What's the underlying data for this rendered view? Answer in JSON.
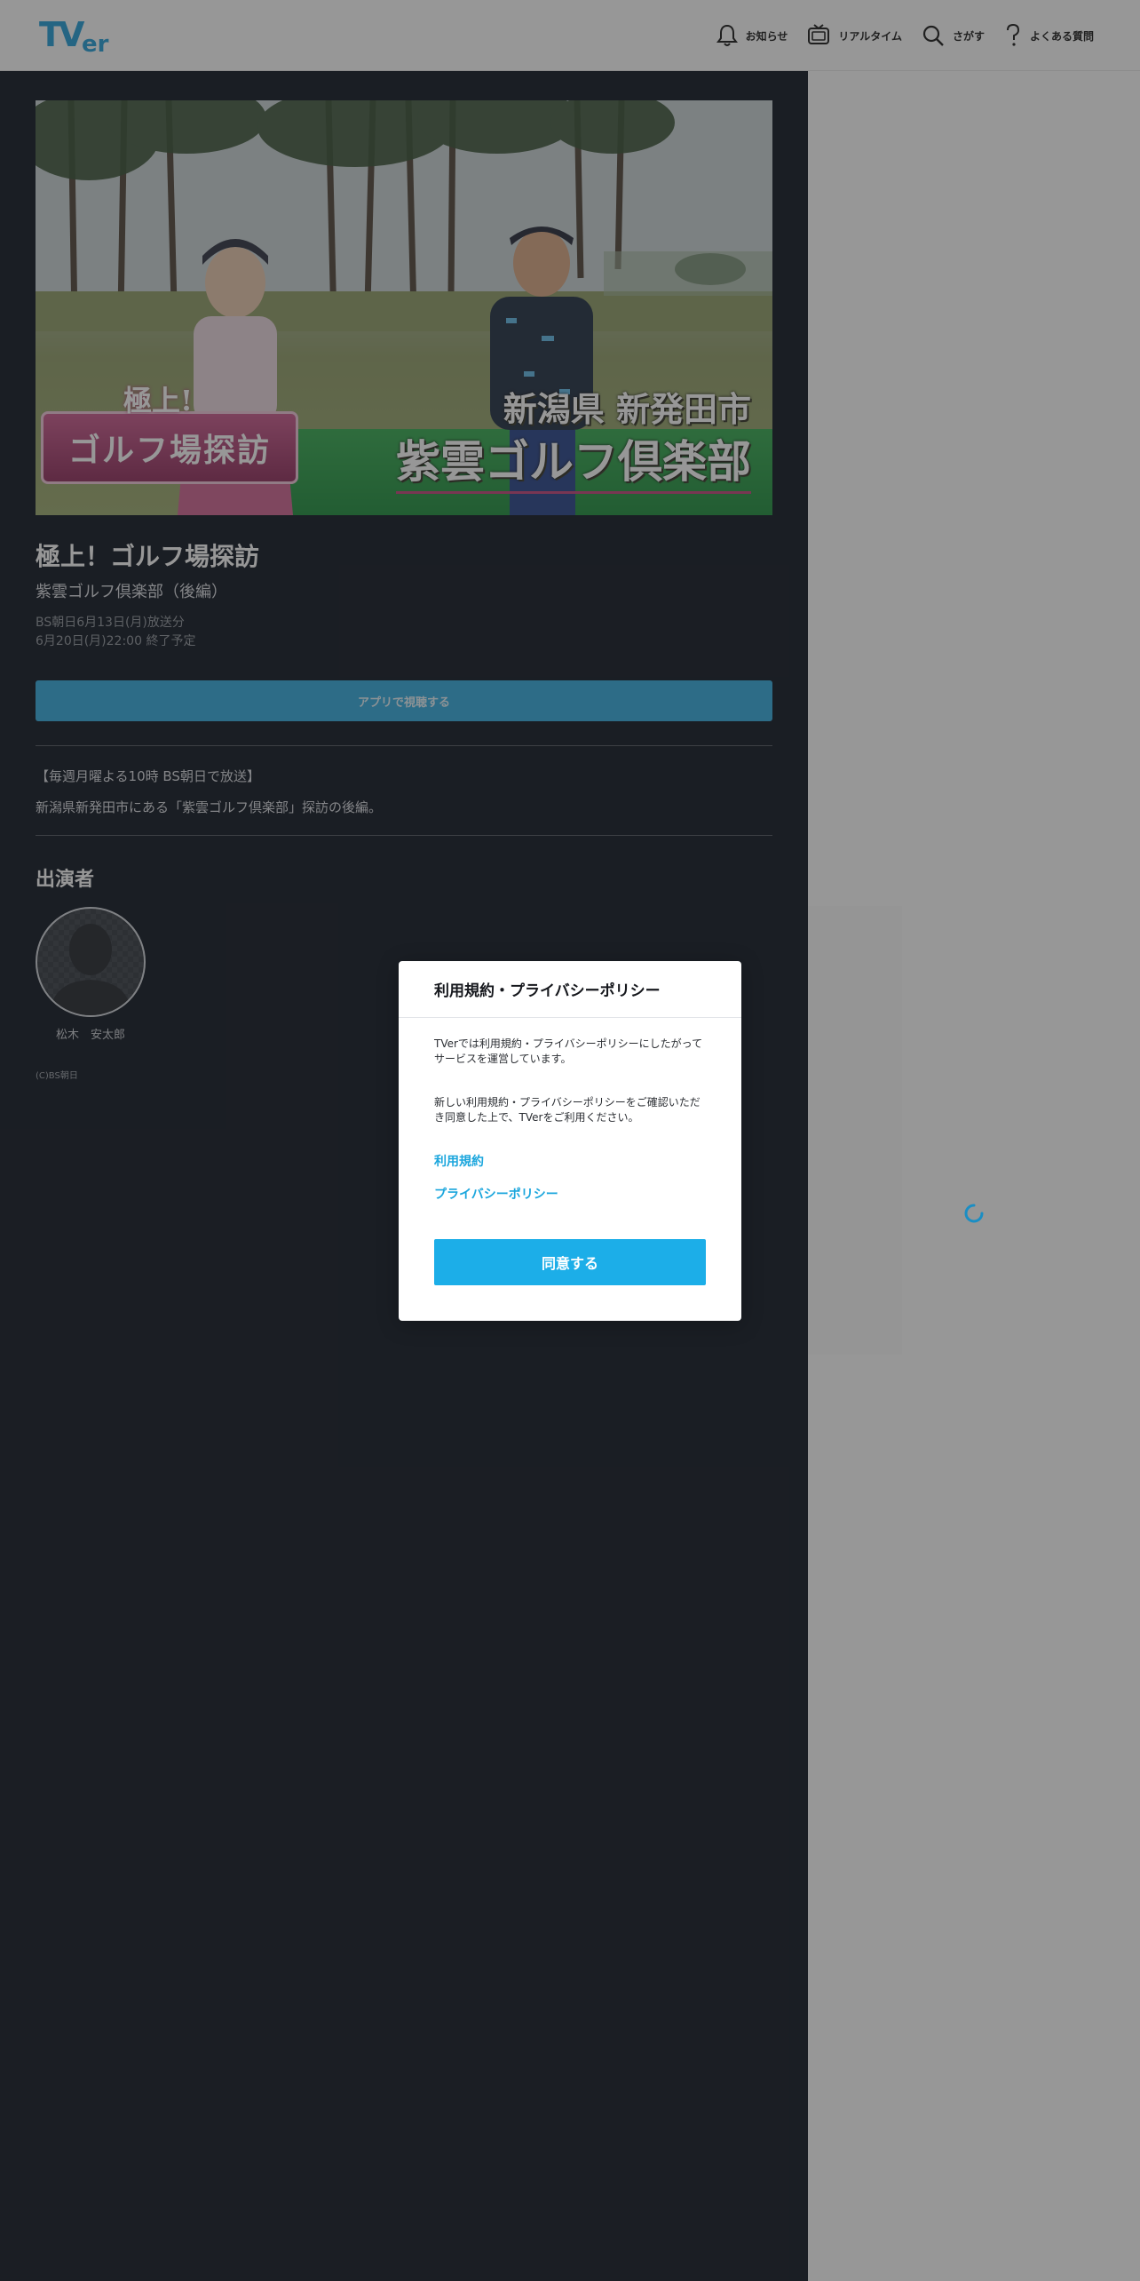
{
  "header": {
    "logo_text": "TVer",
    "nav": [
      {
        "label": "お知らせ",
        "icon": "bell-icon"
      },
      {
        "label": "リアルタイム",
        "icon": "tv-icon"
      },
      {
        "label": "さがす",
        "icon": "search-icon"
      },
      {
        "label": "よくある質問",
        "icon": "question-icon"
      }
    ]
  },
  "thumbnail": {
    "badge_top": "極上!",
    "badge_main": "ゴルフ場探訪",
    "location_line1": "新潟県 新発田市",
    "location_line2": "紫雲ゴルフ倶楽部"
  },
  "episode": {
    "title": "極上！ゴルフ場探訪",
    "subtitle": "紫雲ゴルフ倶楽部（後編）",
    "broadcast": "BS朝日6月13日(月)放送分",
    "end": "6月20日(月)22:00 終了予定",
    "app_button": "アプリで視聴する",
    "description_1": "【毎週月曜よる10時 BS朝日で放送】",
    "description_2": "新潟県新発田市にある「紫雲ゴルフ倶楽部」探訪の後編。"
  },
  "cast": {
    "heading": "出演者",
    "members": [
      {
        "name": "松木　安太郎"
      }
    ]
  },
  "copyright": "(C)BS朝日",
  "modal": {
    "title": "利用規約・プライバシーポリシー",
    "text_1": "TVerでは利用規約・プライバシーポリシーにしたがってサービスを運営しています。",
    "text_2": "新しい利用規約・プライバシーポリシーをご確認いただき同意した上で、TVerをご利用ください。",
    "link_terms": "利用規約",
    "link_privacy": "プライバシーポリシー",
    "agree_button": "同意する"
  },
  "colors": {
    "accent": "#1caee8",
    "dark_bg": "#050c18",
    "logo_blue": "#1a9bd7"
  }
}
